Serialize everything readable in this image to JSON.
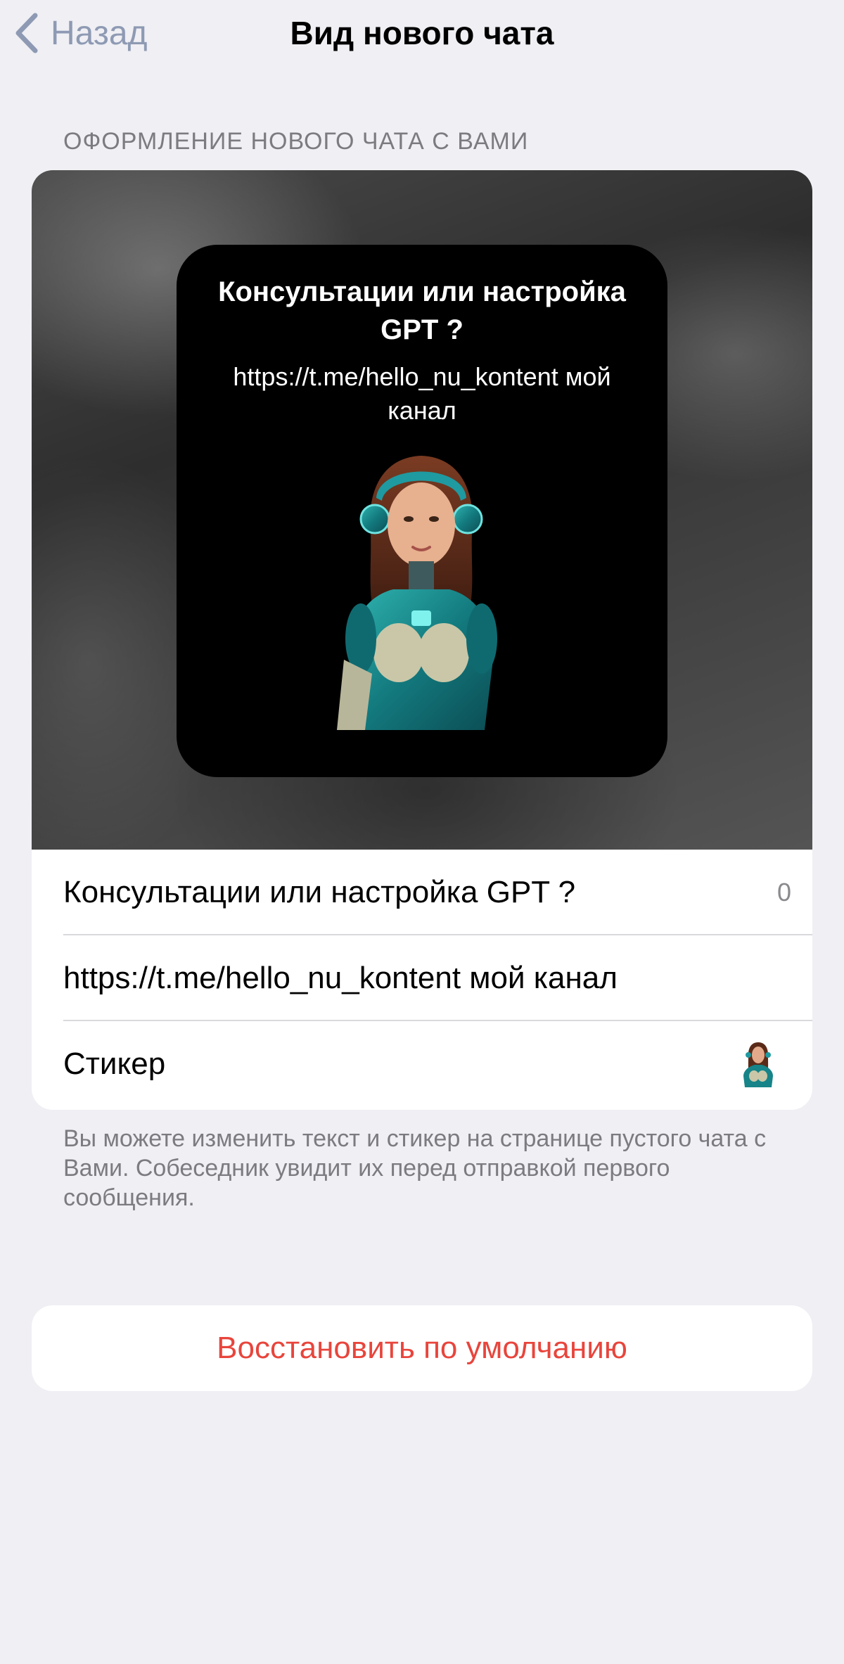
{
  "nav": {
    "back_label": "Назад",
    "title": "Вид нового чата"
  },
  "section": {
    "header": "ОФОРМЛЕНИЕ НОВОГО ЧАТА С ВАМИ"
  },
  "preview": {
    "title": "Консультации или настройка GPT ?",
    "text": "https://t.me/hello_nu_kontent мой канал",
    "sticker_icon": "sticker-girl-icon"
  },
  "fields": {
    "title_value": "Консультации или настройка GPT ?",
    "title_counter": "0",
    "text_value": "https://t.me/hello_nu_kontent мой канал",
    "sticker_label": "Стикер"
  },
  "footer": {
    "note": "Вы можете изменить текст и стикер на странице пустого чата с Вами. Собеседник увидит их перед отправкой первого сообщения."
  },
  "reset": {
    "label": "Восстановить по умолчанию"
  },
  "colors": {
    "accent_back": "#8e9ab3",
    "destructive": "#e8453c",
    "background": "#efeff4"
  }
}
